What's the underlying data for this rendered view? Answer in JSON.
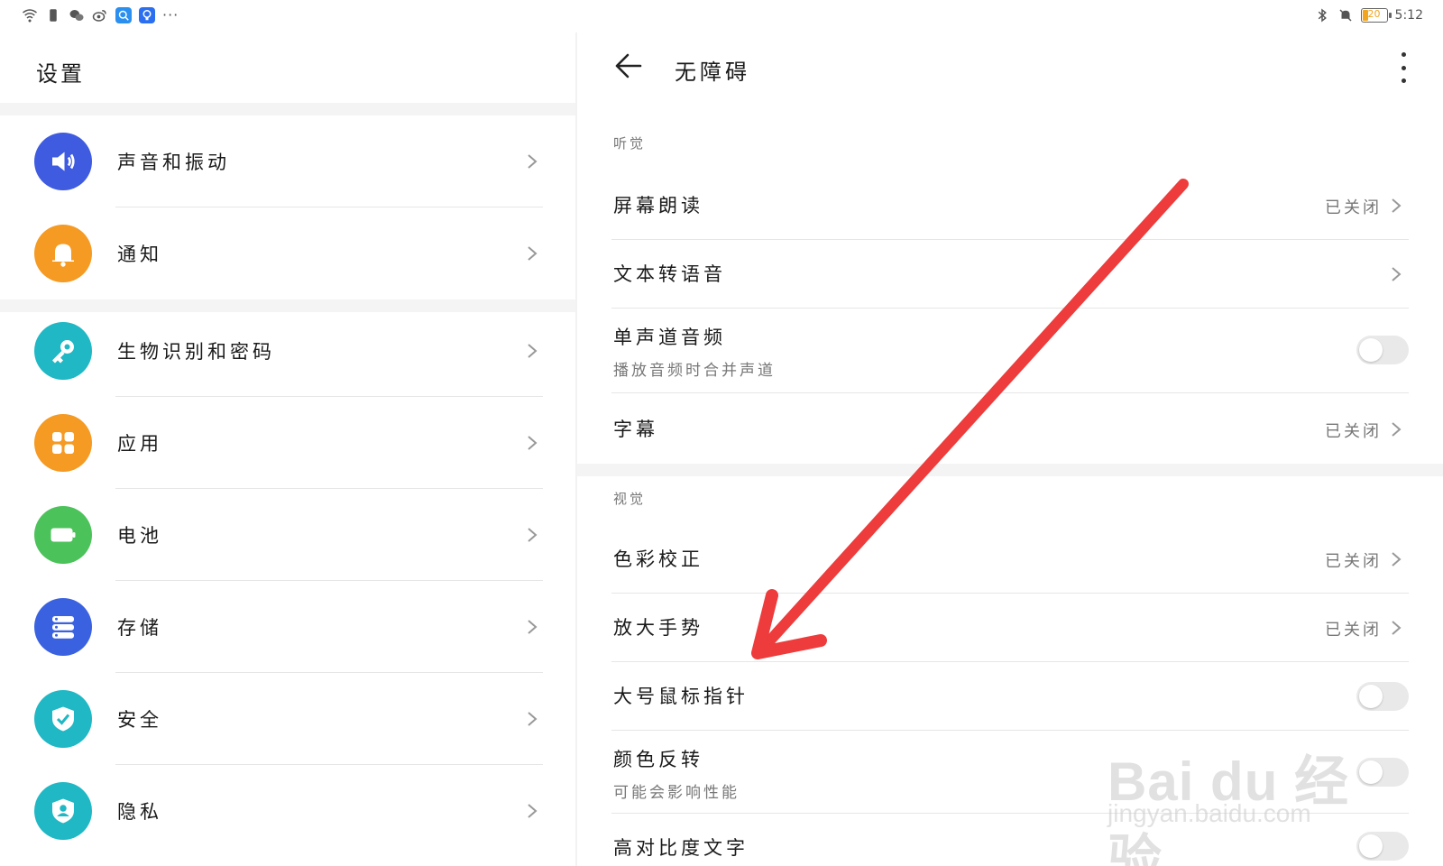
{
  "statusbar": {
    "time": "5:12",
    "battery_level": "20",
    "icons_left": [
      "wifi-icon",
      "sim-icon",
      "wechat-icon",
      "weibo-icon",
      "search-app-icon",
      "tips-app-icon"
    ],
    "more": "···",
    "icons_right": [
      "bluetooth-icon",
      "mute-bell-icon",
      "battery-icon"
    ]
  },
  "left": {
    "title": "设置",
    "items": [
      {
        "label": "声音和振动",
        "icon": "speaker-icon",
        "color": "#3f5be0"
      },
      {
        "label": "通知",
        "icon": "bell-icon",
        "color": "#f59a23"
      },
      {
        "label": "生物识别和密码",
        "icon": "key-icon",
        "color": "#1fb8c4"
      },
      {
        "label": "应用",
        "icon": "apps-grid-icon",
        "color": "#f59a23"
      },
      {
        "label": "电池",
        "icon": "battery-icon",
        "color": "#4cc25a"
      },
      {
        "label": "存储",
        "icon": "storage-icon",
        "color": "#3a62e0"
      },
      {
        "label": "安全",
        "icon": "shield-check-icon",
        "color": "#1fb8c4"
      },
      {
        "label": "隐私",
        "icon": "privacy-icon",
        "color": "#1fb8c4"
      }
    ]
  },
  "right": {
    "title": "无障碍",
    "sections": [
      {
        "label": "听觉",
        "items": [
          {
            "title": "屏幕朗读",
            "status": "已关闭"
          },
          {
            "title": "文本转语音"
          },
          {
            "title": "单声道音频",
            "subtitle": "播放音频时合并声道",
            "toggle": false
          },
          {
            "title": "字幕",
            "status": "已关闭"
          }
        ]
      },
      {
        "label": "视觉",
        "items": [
          {
            "title": "色彩校正",
            "status": "已关闭"
          },
          {
            "title": "放大手势",
            "status": "已关闭"
          },
          {
            "title": "大号鼠标指针",
            "toggle": false
          },
          {
            "title": "颜色反转",
            "subtitle": "可能会影响性能",
            "toggle": false
          },
          {
            "title": "高对比度文字",
            "toggle": false
          }
        ]
      }
    ]
  },
  "annotation": {
    "arrow_color": "#ee3b3b"
  },
  "watermark": {
    "brand": "Bai du 经验",
    "url": "jingyan.baidu.com"
  }
}
